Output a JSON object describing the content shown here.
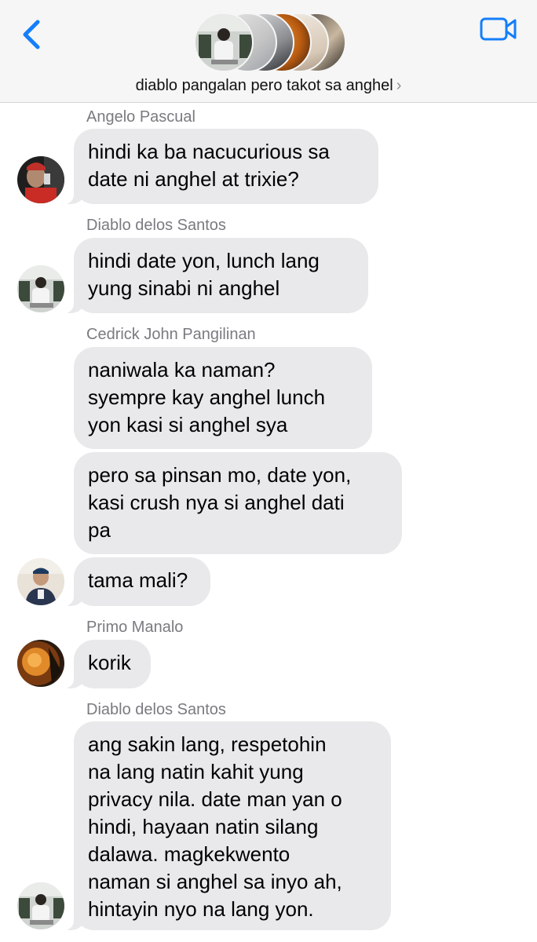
{
  "header": {
    "group_name": "diablo pangalan pero takot sa anghel",
    "chevron": "›",
    "back_icon": "chevron-left-icon",
    "video_icon": "video-camera-icon",
    "accent_color": "#147efb"
  },
  "messages": [
    {
      "sender": "Angelo Pascual",
      "text": "hindi ka ba nacucurious sa\ndate ni anghel at trixie?"
    },
    {
      "sender": "Diablo delos Santos",
      "text": "hindi date yon, lunch lang\nyung sinabi ni anghel"
    },
    {
      "sender": "Cedrick John Pangilinan",
      "text": "naniwala ka naman?\nsyempre kay anghel lunch\nyon kasi si anghel sya"
    },
    {
      "sender": "",
      "text": "pero sa pinsan mo, date yon,\nkasi crush nya si anghel dati\npa"
    },
    {
      "sender": "",
      "text": "tama mali?"
    },
    {
      "sender": "Primo Manalo",
      "text": "korik"
    },
    {
      "sender": "Diablo delos Santos",
      "text": "ang sakin lang, respetohin\nna lang natin kahit yung\nprivacy nila. date man yan o\nhindi, hayaan natin silang\ndalawa. magkekwento\nnaman si anghel sa inyo ah,\nhintayin nyo na lang yon."
    }
  ],
  "colors": {
    "bubble": "#e9e9eb",
    "sender_label": "#7a7a80",
    "header_bg": "#f6f6f6"
  }
}
